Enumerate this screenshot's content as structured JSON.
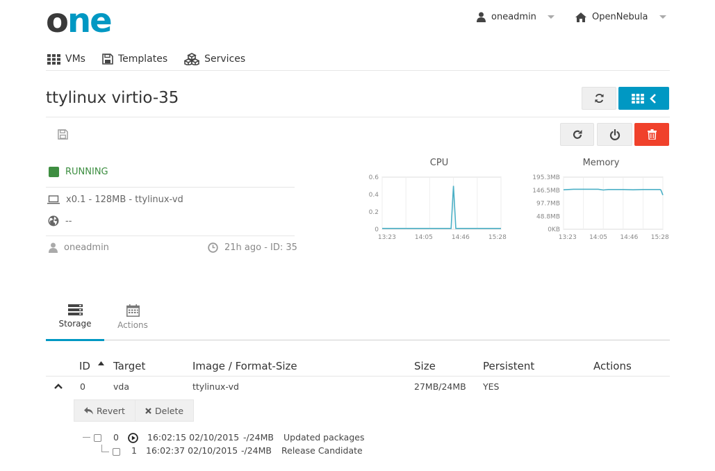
{
  "header": {
    "logo_text": "one",
    "user": "oneadmin",
    "zone": "OpenNebula"
  },
  "nav": {
    "items": [
      {
        "label": "VMs",
        "icon": "grid-icon"
      },
      {
        "label": "Templates",
        "icon": "save-icon"
      },
      {
        "label": "Services",
        "icon": "cubes-icon"
      }
    ]
  },
  "vm": {
    "name": "ttylinux virtio-35",
    "state": "RUNNING",
    "capacity": "x0.1 - 128MB - ttylinux-vd",
    "ips": "--",
    "owner": "oneadmin",
    "age_id": "21h ago - ID: 35"
  },
  "charts": {
    "cpu_title": "CPU",
    "memory_title": "Memory"
  },
  "chart_data": [
    {
      "type": "line",
      "title": "CPU",
      "x_ticks": [
        "13:23",
        "14:05",
        "14:46",
        "15:28"
      ],
      "y_ticks": [
        "0",
        "0.2",
        "0.4",
        "0.6"
      ],
      "ylim": [
        0,
        0.6
      ],
      "series": [
        {
          "x": [
            0,
            0.05,
            0.1,
            0.15,
            0.2,
            0.25,
            0.3,
            0.35,
            0.4,
            0.45,
            0.5,
            0.55,
            0.58,
            0.6,
            0.62,
            0.65,
            0.7,
            0.75,
            0.8,
            0.85,
            0.9,
            0.95,
            1.0
          ],
          "values": [
            0.01,
            0.01,
            0.01,
            0.01,
            0.01,
            0.01,
            0.01,
            0.01,
            0.01,
            0.01,
            0.01,
            0.01,
            0.01,
            0.5,
            0.01,
            0.01,
            0.01,
            0.01,
            0.01,
            0.01,
            0.01,
            0.01,
            0.01
          ]
        }
      ]
    },
    {
      "type": "line",
      "title": "Memory",
      "x_ticks": [
        "13:23",
        "14:05",
        "14:46",
        "15:28"
      ],
      "y_ticks": [
        "0KB",
        "48.8MB",
        "97.7MB",
        "146.5MB",
        "195.3MB"
      ],
      "ylim": [
        0,
        195.3
      ],
      "series": [
        {
          "x": [
            0,
            0.05,
            0.1,
            0.2,
            0.3,
            0.35,
            0.4,
            0.45,
            0.5,
            0.6,
            0.7,
            0.8,
            0.9,
            0.97,
            0.98,
            1.0
          ],
          "values": [
            148,
            149,
            150,
            150,
            150,
            150,
            147,
            149,
            149,
            149,
            148,
            149,
            149,
            149,
            147,
            128
          ]
        }
      ]
    }
  ],
  "tabs": [
    {
      "label": "Storage"
    },
    {
      "label": "Actions"
    }
  ],
  "storage": {
    "headers": [
      "ID",
      "Target",
      "Image / Format-Size",
      "Size",
      "Persistent",
      "Actions"
    ],
    "row": {
      "id": "0",
      "target": "vda",
      "image": "ttylinux-vd",
      "size": "27MB/24MB",
      "persistent": "YES"
    },
    "revert_label": "Revert",
    "delete_label": "Delete",
    "snapshots": [
      {
        "id": "0",
        "date": "16:02:15 02/10/2015",
        "size": "-/24MB",
        "name": "Updated packages",
        "active": true
      },
      {
        "id": "1",
        "date": "16:02:37 02/10/2015",
        "size": "-/24MB",
        "name": "Release Candidate",
        "active": false
      }
    ]
  },
  "colors": {
    "accent": "#0098c3",
    "running": "#3e8e41",
    "danger": "#f0412b",
    "chart_line": "#4bb0c6"
  }
}
